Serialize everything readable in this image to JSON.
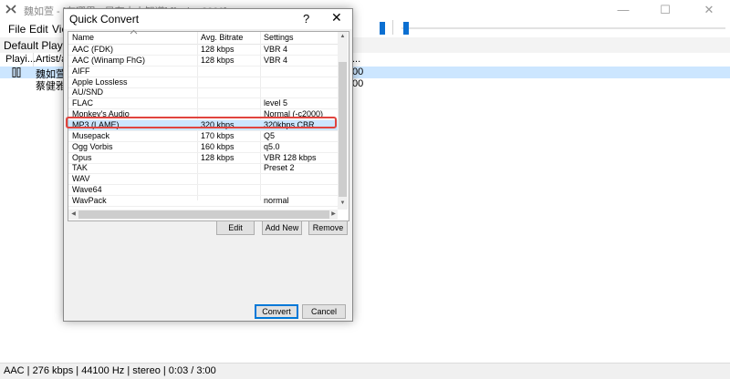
{
  "window": {
    "title": "魏如萱 - [在哪里 - 只有大人知道] [foobar2000]",
    "menu": [
      "File",
      "Edit",
      "View"
    ],
    "minimize_glyph": "—",
    "maximize_glyph": "☐",
    "close_glyph": "✕"
  },
  "playlist": {
    "tab_label": "Default Playlist",
    "columns": [
      "Playi...",
      "Artist/a...",
      "..."
    ],
    "rows": [
      {
        "artist": "魏如萱 -",
        "end": "00",
        "playing": true
      },
      {
        "artist": "蔡健雅 -",
        "end": "00",
        "playing": false
      }
    ]
  },
  "status_bar": {
    "text": "AAC | 276 kbps | 44100 Hz | stereo | 0:03 / 3:00"
  },
  "dialog": {
    "title": "Quick Convert",
    "help_glyph": "?",
    "close_glyph": "✕",
    "columns": [
      "Name",
      "Avg. Bitrate",
      "Settings"
    ],
    "presets": [
      {
        "name": "AAC (FDK)",
        "bitrate": "128 kbps",
        "settings": "VBR 4"
      },
      {
        "name": "AAC (Winamp FhG)",
        "bitrate": "128 kbps",
        "settings": "VBR 4"
      },
      {
        "name": "AIFF",
        "bitrate": "",
        "settings": ""
      },
      {
        "name": "Apple Lossless",
        "bitrate": "",
        "settings": ""
      },
      {
        "name": "AU/SND",
        "bitrate": "",
        "settings": ""
      },
      {
        "name": "FLAC",
        "bitrate": "",
        "settings": "level 5"
      },
      {
        "name": "Monkey's Audio",
        "bitrate": "",
        "settings": "Normal (-c2000)"
      },
      {
        "name": "MP3 (LAME)",
        "bitrate": "320 kbps",
        "settings": "320kbps CBR"
      },
      {
        "name": "Musepack",
        "bitrate": "170 kbps",
        "settings": "Q5"
      },
      {
        "name": "Ogg Vorbis",
        "bitrate": "160 kbps",
        "settings": "q5.0"
      },
      {
        "name": "Opus",
        "bitrate": "128 kbps",
        "settings": "VBR 128 kbps"
      },
      {
        "name": "TAK",
        "bitrate": "",
        "settings": "Preset 2"
      },
      {
        "name": "WAV",
        "bitrate": "",
        "settings": ""
      },
      {
        "name": "Wave64",
        "bitrate": "",
        "settings": ""
      },
      {
        "name": "WavPack",
        "bitrate": "",
        "settings": "normal"
      }
    ],
    "selected_preset": "MP3 (LAME)",
    "buttons": {
      "edit": "Edit",
      "add_new": "Add New",
      "remove": "Remove",
      "convert": "Convert",
      "cancel": "Cancel"
    }
  },
  "colors": {
    "accent": "#0b6fd1",
    "selection": "#cce6ff",
    "highlight_outline": "#e0443e"
  }
}
